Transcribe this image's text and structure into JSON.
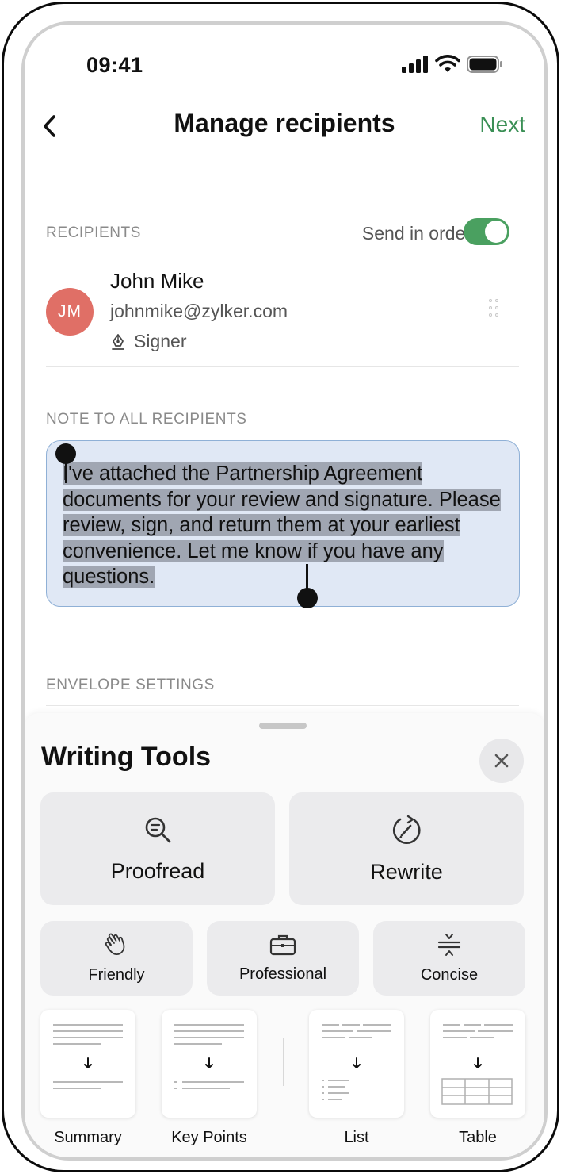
{
  "status": {
    "time": "09:41"
  },
  "nav": {
    "title": "Manage recipients",
    "next": "Next"
  },
  "recipients": {
    "section_label": "RECIPIENTS",
    "send_in_order_label": "Send in order",
    "send_in_order_on": true,
    "items": [
      {
        "initials": "JM",
        "name": "John Mike",
        "email": "johnmike@zylker.com",
        "role": "Signer",
        "avatar_color": "#e06f66"
      }
    ]
  },
  "note": {
    "section_label": "NOTE TO ALL RECIPIENTS",
    "text": "I've attached the Partnership Agreement documents for your review and signature. Please review, sign, and return them at your earliest convenience. Let me know if you have any questions."
  },
  "envelope": {
    "section_label": "ENVELOPE SETTINGS"
  },
  "writing_tools": {
    "title": "Writing Tools",
    "primary": [
      {
        "label": "Proofread",
        "icon": "magnifier-icon"
      },
      {
        "label": "Rewrite",
        "icon": "rewrite-icon"
      }
    ],
    "tones": [
      {
        "label": "Friendly",
        "icon": "wave-hand-icon"
      },
      {
        "label": "Professional",
        "icon": "briefcase-icon"
      },
      {
        "label": "Concise",
        "icon": "compress-icon"
      }
    ],
    "formats": [
      {
        "label": "Summary"
      },
      {
        "label": "Key Points"
      },
      {
        "label": "List"
      },
      {
        "label": "Table"
      }
    ]
  },
  "colors": {
    "accent": "#3a8f55",
    "selection": "#a0a6b2",
    "note_bg": "#e0e8f5"
  }
}
